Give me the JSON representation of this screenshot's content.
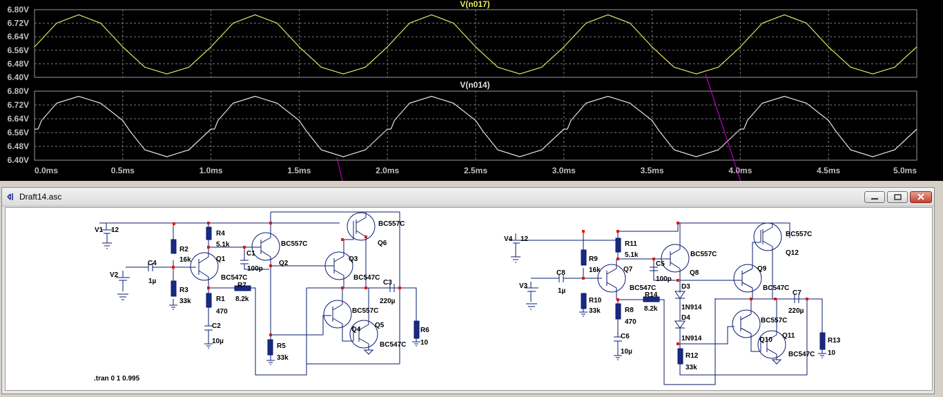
{
  "waveform": {
    "time_ticks": [
      "0.0ms",
      "0.5ms",
      "1.0ms",
      "1.5ms",
      "2.0ms",
      "2.5ms",
      "3.0ms",
      "3.5ms",
      "4.0ms",
      "4.5ms",
      "5.0ms"
    ],
    "volt_ticks": [
      "6.80V",
      "6.72V",
      "6.64V",
      "6.56V",
      "6.48V",
      "6.40V"
    ],
    "colors": {
      "background": "#000000",
      "trace_top": "#e8e860",
      "trace_bottom": "#e0e0e0",
      "grid": "#7a7a7a",
      "probe_line": "#e000e0"
    }
  },
  "chart_data": [
    {
      "type": "line",
      "title": "V(n017)",
      "xlim": [
        0,
        5.0
      ],
      "ylim": [
        6.4,
        6.8
      ],
      "series": [
        {
          "name": "V(n017)",
          "x": [
            0,
            0.125,
            0.25,
            0.375,
            0.5,
            0.625,
            0.75,
            0.875,
            1.0
          ],
          "values": [
            6.58,
            6.72,
            6.77,
            6.72,
            6.58,
            6.46,
            6.42,
            6.46,
            6.58
          ]
        }
      ],
      "period_ms": 1.0
    },
    {
      "type": "line",
      "title": "V(n014)",
      "xlim": [
        0,
        5.0
      ],
      "ylim": [
        6.4,
        6.8
      ],
      "series": [
        {
          "name": "V(n014)",
          "x": [
            0,
            0.02,
            0.04,
            0.125,
            0.25,
            0.375,
            0.5,
            0.52,
            0.54,
            0.625,
            0.75,
            0.875,
            1.0
          ],
          "values": [
            6.58,
            6.58,
            6.63,
            6.73,
            6.77,
            6.73,
            6.63,
            6.6,
            6.57,
            6.46,
            6.42,
            6.46,
            6.58
          ]
        }
      ],
      "period_ms": 1.0
    }
  ],
  "window": {
    "title": "Draft14.asc",
    "icon": "ltspice-icon"
  },
  "schematic": {
    "directive": ".tran 0 1 0.995",
    "labels": {
      "V1": "V1",
      "V1v": "12",
      "V2": "V2",
      "C4": "C4",
      "C4v": "1µ",
      "R2": "R2",
      "R2v": "16k",
      "R3": "R3",
      "R3v": "33k",
      "R4": "R4",
      "R4v": "5.1k",
      "Q1": "Q1",
      "Q1t": "BC547C",
      "R1": "R1",
      "R1v": "470",
      "C2": "C2",
      "C2v": "10µ",
      "R7": "R7",
      "R7v": "8.2k",
      "C1": "C1",
      "C1v": "100p",
      "Q2t": "BC557C",
      "Q2": "Q2",
      "R5": "R5",
      "R5v": "33k",
      "Q3": "Q3",
      "Q3t": "BC547C",
      "Q6t": "BC557C",
      "Q6": "Q6",
      "Q4t": "BC557C",
      "Q4": "Q4",
      "Q5": "Q5",
      "Q5t": "BC547C",
      "C3": "C3",
      "C3v": "220µ",
      "R6": "R6",
      "R6v": "10",
      "V4": "V4",
      "V4v": "12",
      "V3": "V3",
      "C8": "C8",
      "C8v": "1µ",
      "R9": "R9",
      "R9v": "16k",
      "R10": "R10",
      "R10v": "33k",
      "R11": "R11",
      "R11v": "5.1k",
      "Q7": "Q7",
      "Q7t": "BC547C",
      "R8": "R8",
      "R8v": "470",
      "C6": "C6",
      "C6v": "10µ",
      "R14": "R14",
      "R14v": "8.2k",
      "C5": "C5",
      "C5v": "100p",
      "Q8t": "BC557C",
      "Q8": "Q8",
      "D3": "D3",
      "D3t": "1N914",
      "D4": "D4",
      "D4t": "1N914",
      "R12": "R12",
      "R12v": "33k",
      "Q9": "Q9",
      "Q9t": "BC547C",
      "Q12t": "BC557C",
      "Q12": "Q12",
      "Q10t": "BC557C",
      "Q10": "Q10",
      "Q11": "Q11",
      "Q11t": "BC547C",
      "C7": "C7",
      "C7v": "220µ",
      "R13": "R13",
      "R13v": "10"
    }
  }
}
